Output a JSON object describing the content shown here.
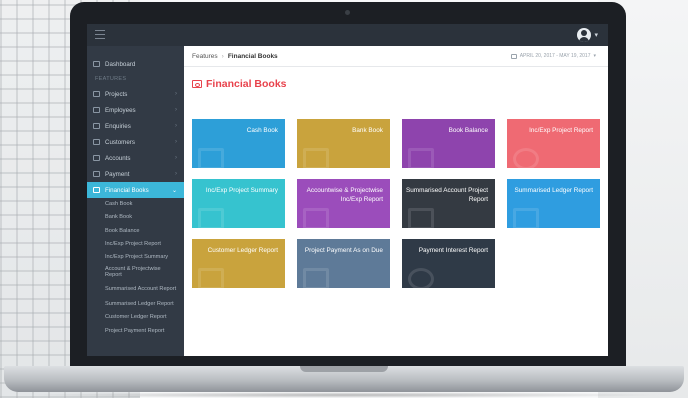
{
  "topbar": {
    "user_caret": "▾"
  },
  "sidebar": {
    "dashboard": "Dashboard",
    "features_label": "FEATURES",
    "items": [
      "Projects",
      "Employees",
      "Enquiries",
      "Customers",
      "Accounts",
      "Payment"
    ],
    "active_item": "Financial Books",
    "sub_items": [
      "Cash Book",
      "Bank Book",
      "Book Balance",
      "Inc/Exp Project Report",
      "Inc/Exp Project Summary",
      "Account & Projectwise Report",
      "Summarised Account Report",
      "Summarised Ledger Report",
      "Customer Ledger Report",
      "Project Payment Report"
    ]
  },
  "breadcrumb": {
    "parent": "Features",
    "separator": "›",
    "current": "Financial Books"
  },
  "date_range": "APRIL 20, 2017 - MAY 19, 2017",
  "page_title": "Financial Books",
  "tiles": [
    {
      "label": "Cash Book",
      "color": "#2d9fd8"
    },
    {
      "label": "Bank Book",
      "color": "#c9a33d"
    },
    {
      "label": "Book Balance",
      "color": "#8e44ad"
    },
    {
      "label": "Inc/Exp Project Report",
      "color": "#ef6a73"
    },
    {
      "label": "Inc/Exp Project Summary",
      "color": "#36c3cf"
    },
    {
      "label": "Accountwise & Projectwise Inc/Exp Report",
      "color": "#9b4dbb"
    },
    {
      "label": "Summarised Account Project Report",
      "color": "#343a42"
    },
    {
      "label": "Summarised Ledger Report",
      "color": "#2f9de0"
    },
    {
      "label": "Customer Ledger Report",
      "color": "#c9a33d"
    },
    {
      "label": "Project Payment As on Due",
      "color": "#5e7a98"
    },
    {
      "label": "Payment Interest Report",
      "color": "#2f3a47"
    }
  ]
}
